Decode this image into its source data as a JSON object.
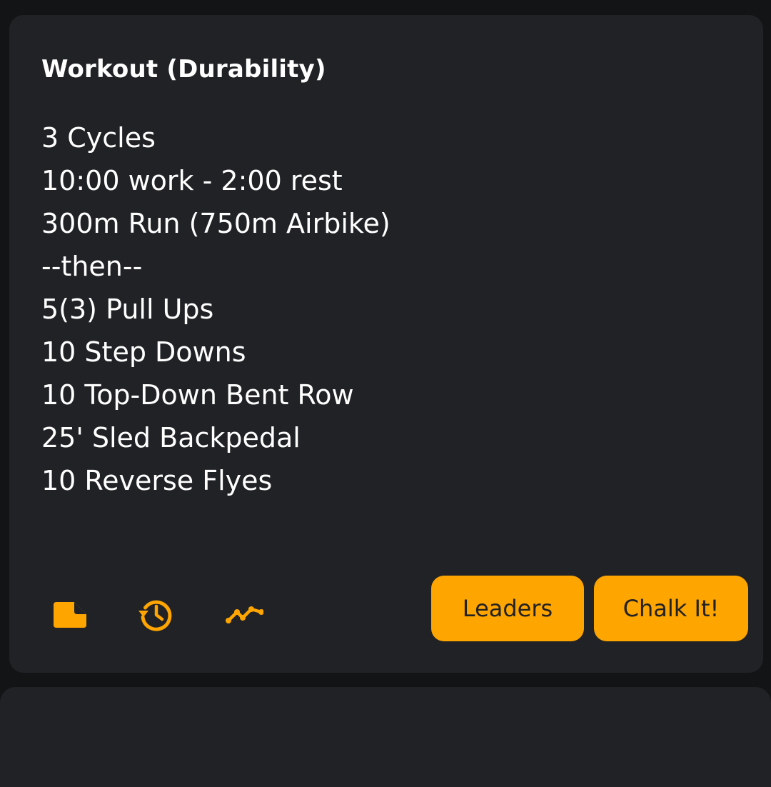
{
  "workout": {
    "title": "Workout (Durability)",
    "lines": [
      "3 Cycles",
      "10:00 work - 2:00 rest",
      "300m Run (750m Airbike)",
      "--then--",
      "5(3) Pull Ups",
      "10 Step Downs",
      "10 Top-Down Bent Row",
      "25' Sled Backpedal",
      "10 Reverse Flyes"
    ]
  },
  "actions": {
    "icons": [
      "note-icon",
      "history-icon",
      "trend-chart-icon"
    ],
    "leaders_label": "Leaders",
    "chalk_label": "Chalk It!"
  },
  "colors": {
    "background": "#131415",
    "card": "#202226",
    "accent": "#ffa500",
    "text": "#ffffff",
    "button_text": "#222222"
  }
}
